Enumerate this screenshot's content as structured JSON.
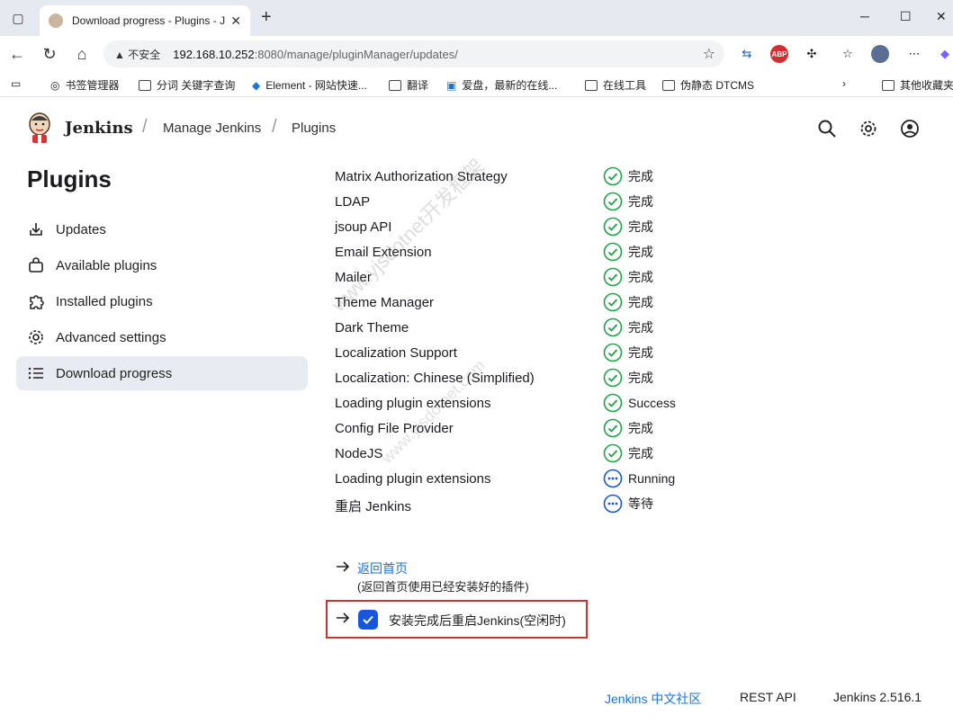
{
  "browser": {
    "tab_title": "Download progress - Plugins - Jenkins",
    "url_warning": "不安全",
    "url_host": "192.168.10.252",
    "url_rest": ":8080/manage/pluginManager/updates/",
    "bookmarks": [
      "书签管理器",
      "分词 关键字查询",
      "Element - 网站快速...",
      "翻译",
      "爱盘，最新的在线...",
      "在线工具",
      "伪静态 DTCMS",
      "其他收藏夹"
    ]
  },
  "header": {
    "brand": "Jenkins",
    "crumbs": [
      "Manage Jenkins",
      "Plugins"
    ]
  },
  "sidebar": {
    "title": "Plugins",
    "items": [
      {
        "label": "Updates",
        "icon": "download-icon"
      },
      {
        "label": "Available plugins",
        "icon": "shopping-bag-icon"
      },
      {
        "label": "Installed plugins",
        "icon": "puzzle-icon"
      },
      {
        "label": "Advanced settings",
        "icon": "gear-icon"
      },
      {
        "label": "Download progress",
        "icon": "list-icon",
        "active": true
      }
    ]
  },
  "plugins": [
    {
      "name": "Matrix Authorization Strategy",
      "status": "完成",
      "state": "done"
    },
    {
      "name": "LDAP",
      "status": "完成",
      "state": "done"
    },
    {
      "name": "jsoup API",
      "status": "完成",
      "state": "done"
    },
    {
      "name": "Email Extension",
      "status": "完成",
      "state": "done"
    },
    {
      "name": "Mailer",
      "status": "完成",
      "state": "done"
    },
    {
      "name": "Theme Manager",
      "status": "完成",
      "state": "done"
    },
    {
      "name": "Dark Theme",
      "status": "完成",
      "state": "done"
    },
    {
      "name": "Localization Support",
      "status": "完成",
      "state": "done"
    },
    {
      "name": "Localization: Chinese (Simplified)",
      "status": "完成",
      "state": "done"
    },
    {
      "name": "Loading plugin extensions",
      "status": "Success",
      "state": "done"
    },
    {
      "name": "Config File Provider",
      "status": "完成",
      "state": "done"
    },
    {
      "name": "NodeJS",
      "status": "完成",
      "state": "done"
    },
    {
      "name": "Loading plugin extensions",
      "status": "Running",
      "state": "pending"
    },
    {
      "name": "重启 Jenkins",
      "status": "等待",
      "state": "pending"
    }
  ],
  "actions": {
    "back_link": "返回首页",
    "back_note": "(返回首页使用已经安装好的插件)",
    "restart_label": "安装完成后重启Jenkins(空闲时)",
    "restart_checked": true
  },
  "footer": {
    "community": "Jenkins 中文社区",
    "rest_api": "REST API",
    "version": "Jenkins 2.516.1"
  },
  "watermark": {
    "line1": "www.yjsdotnet开发框架",
    "line2": "www.yjsdotnet.com"
  },
  "colors": {
    "accent": "#1a73e8",
    "success": "#1ea446",
    "pending": "#1a56db",
    "highlight": "#d32f2f",
    "active_bg": "#e8ebf1"
  }
}
